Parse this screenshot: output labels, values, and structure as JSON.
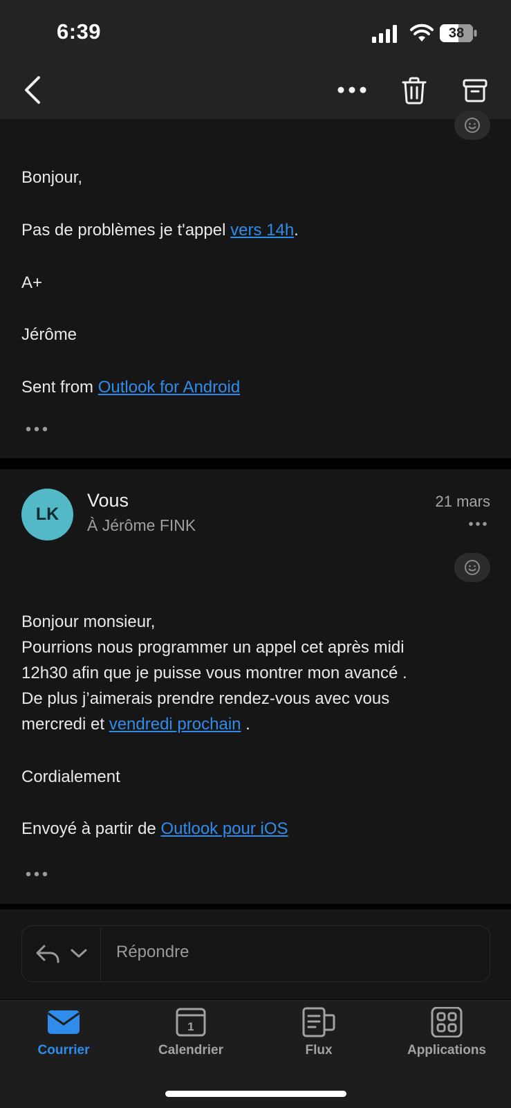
{
  "status_bar": {
    "time": "6:39",
    "battery": "38"
  },
  "message1": {
    "greeting": "Bonjour,",
    "line1_before": "Pas de problèmes je t'appel ",
    "line1_link": "vers 14h",
    "line1_after": ".",
    "line2": "A+",
    "signature": "Jérôme",
    "footer_before": "Sent from ",
    "footer_link": "Outlook for Android"
  },
  "message2": {
    "avatar_initials": "LK",
    "sender": "Vous",
    "recipient": "À Jérôme FINK",
    "date": "21 mars",
    "greeting": "Bonjour monsieur,",
    "line1": "Pourrions nous programmer un appel cet après midi",
    "line2": "12h30 afin que je puisse vous montrer mon avancé .",
    "line3": "De plus j’aimerais prendre rendez-vous avec vous",
    "line4_before": "mercredi et ",
    "line4_link": "vendredi prochain",
    "line4_after": " .",
    "closing": "Cordialement",
    "footer_before": "Envoyé à partir de ",
    "footer_link": "Outlook pour iOS"
  },
  "reply": {
    "placeholder": "Répondre"
  },
  "tabs": [
    {
      "label": "Courrier",
      "icon": "mail-icon",
      "active": true
    },
    {
      "label": "Calendrier",
      "icon": "calendar-icon",
      "active": false,
      "day": "1"
    },
    {
      "label": "Flux",
      "icon": "feed-icon",
      "active": false
    },
    {
      "label": "Applications",
      "icon": "apps-icon",
      "active": false
    }
  ],
  "colors": {
    "accent": "#2f8cea",
    "avatar": "#53b9c7",
    "background": "#161616"
  }
}
